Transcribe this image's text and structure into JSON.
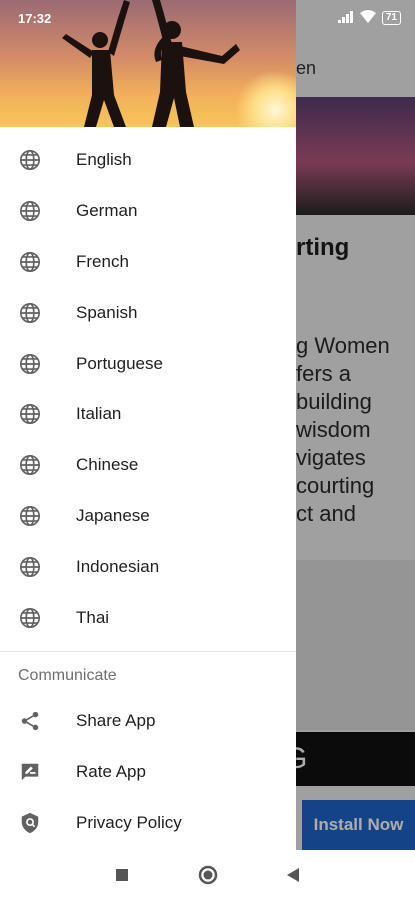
{
  "status_bar": {
    "time": "17:32",
    "battery": "71"
  },
  "background_app": {
    "header_fragment": "en",
    "article_title_fragment": "rting",
    "description_fragment": "g Women\nfers a\nbuilding\nwisdom\nvigates\ncourting\nct and",
    "banner_text": "G",
    "install_button": "Install Now"
  },
  "drawer": {
    "languages": [
      {
        "label": "English",
        "icon": "globe-icon"
      },
      {
        "label": "German",
        "icon": "globe-icon"
      },
      {
        "label": "French",
        "icon": "globe-icon"
      },
      {
        "label": "Spanish",
        "icon": "globe-icon"
      },
      {
        "label": "Portuguese",
        "icon": "globe-icon"
      },
      {
        "label": "Italian",
        "icon": "globe-icon"
      },
      {
        "label": "Chinese",
        "icon": "globe-icon"
      },
      {
        "label": "Japanese",
        "icon": "globe-icon"
      },
      {
        "label": "Indonesian",
        "icon": "globe-icon"
      },
      {
        "label": "Thai",
        "icon": "globe-icon"
      }
    ],
    "communicate": {
      "title": "Communicate",
      "items": [
        {
          "label": "Share App",
          "icon": "share-icon"
        },
        {
          "label": "Rate App",
          "icon": "rate-review-icon"
        },
        {
          "label": "Privacy Policy",
          "icon": "shield-icon"
        }
      ]
    }
  },
  "nav_bar": {
    "icons": [
      "recents-square-icon",
      "home-circle-icon",
      "back-triangle-icon"
    ]
  },
  "colors": {
    "install_button": "#1e63c8",
    "icon_gray": "#616161",
    "divider": "#e2e2e2"
  }
}
